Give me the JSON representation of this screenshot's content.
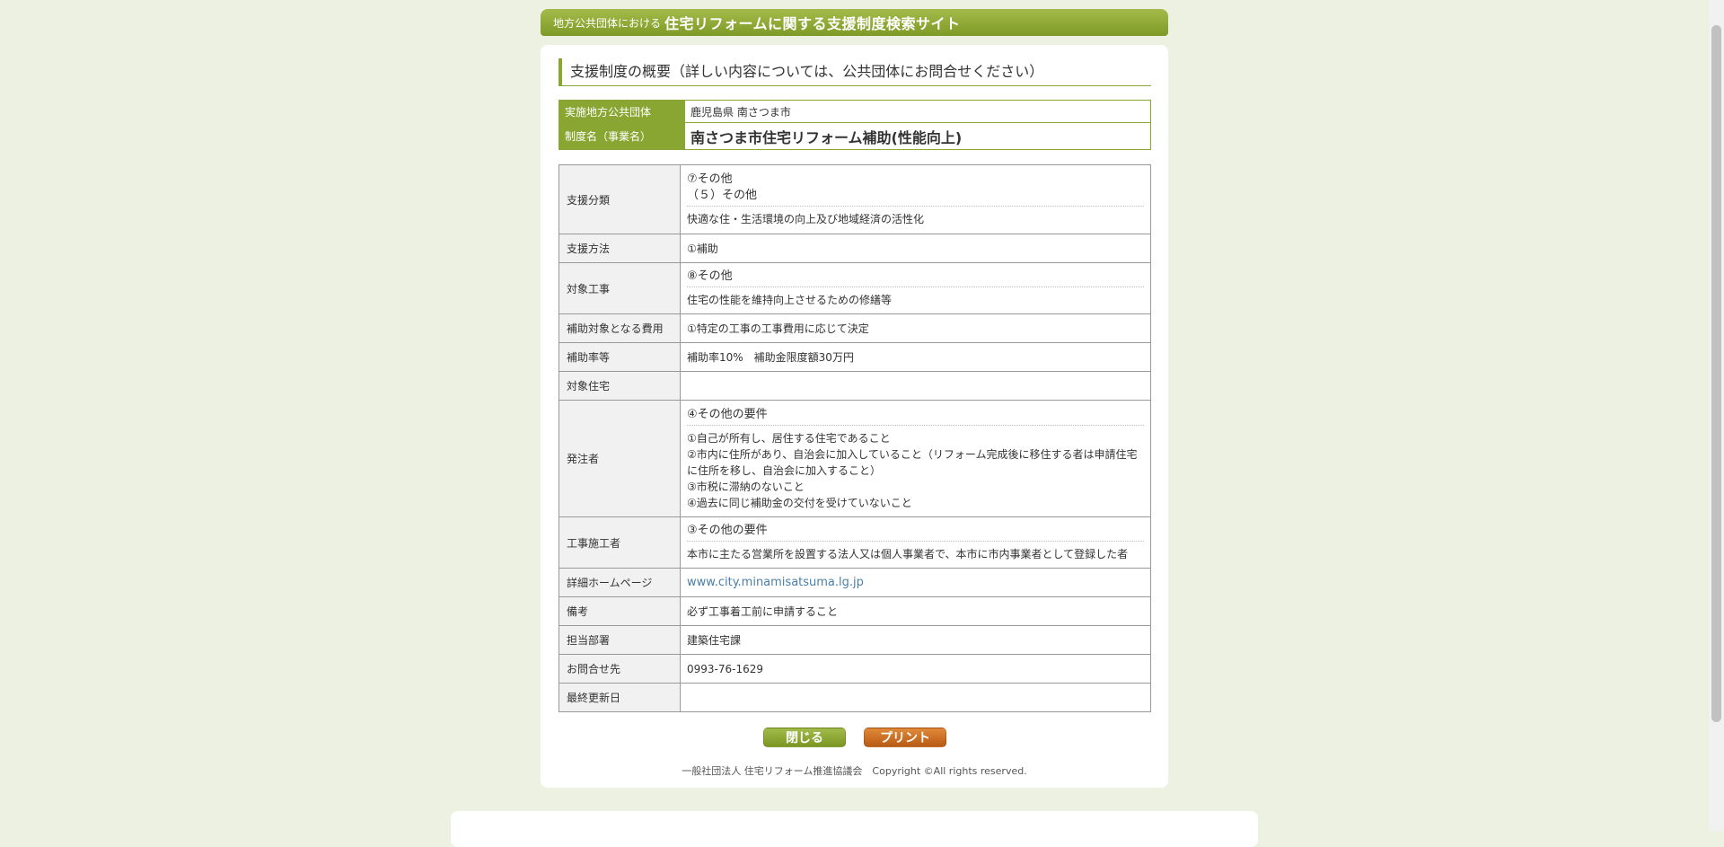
{
  "header": {
    "sub": "地方公共団体における",
    "main": "住宅リフォームに関する支援制度検索サイト"
  },
  "section_title": "支援制度の概要（詳しい内容については、公共団体にお問合せください）",
  "summary": {
    "org_label": "実施地方公共団体",
    "org_value": "鹿児島県 南さつま市",
    "name_label": "制度名（事業名）",
    "name_value": "南さつま市住宅リフォーム補助(性能向上)"
  },
  "details": {
    "support_category": {
      "label": "支援分類",
      "line1": "⑦その他",
      "line2": "（５）その他",
      "note": "快適な住・生活環境の向上及び地域経済の活性化"
    },
    "support_method": {
      "label": "支援方法",
      "value": "①補助"
    },
    "target_work": {
      "label": "対象工事",
      "head": "⑧その他",
      "note": "住宅の性能を維持向上させるための修繕等"
    },
    "eligible_cost": {
      "label": "補助対象となる費用",
      "value": "①特定の工事の工事費用に応じて決定"
    },
    "subsidy_rate": {
      "label": "補助率等",
      "value": "補助率10%　補助金限度額30万円"
    },
    "target_house": {
      "label": "対象住宅",
      "value": ""
    },
    "orderer": {
      "label": "発注者",
      "head": "④その他の要件",
      "lines": [
        "①自己が所有し、居住する住宅であること",
        "②市内に住所があり、自治会に加入していること（リフォーム完成後に移住する者は申請住宅に住所を移し、自治会に加入すること）",
        "③市税に滞納のないこと",
        "④過去に同じ補助金の交付を受けていないこと"
      ]
    },
    "contractor": {
      "label": "工事施工者",
      "head": "③その他の要件",
      "note": "本市に主たる営業所を設置する法人又は個人事業者で、本市に市内事業者として登録した者"
    },
    "homepage": {
      "label": "詳細ホームページ",
      "value": "www.city.minamisatsuma.lg.jp"
    },
    "remarks": {
      "label": "備考",
      "value": "必ず工事着工前に申請すること"
    },
    "department": {
      "label": "担当部署",
      "value": "建築住宅課"
    },
    "contact": {
      "label": "お問合せ先",
      "value": "0993-76-1629"
    },
    "last_updated": {
      "label": "最終更新日",
      "value": ""
    }
  },
  "buttons": {
    "close": "閉じる",
    "print": "プリント"
  },
  "footer": "一般社団法人 住宅リフォーム推進協議会　Copyright ©All rights reserved.",
  "colors": {
    "accent": "#8aa632",
    "print": "#c8691e",
    "link": "#4a7fa8",
    "background": "#edf1e1"
  }
}
